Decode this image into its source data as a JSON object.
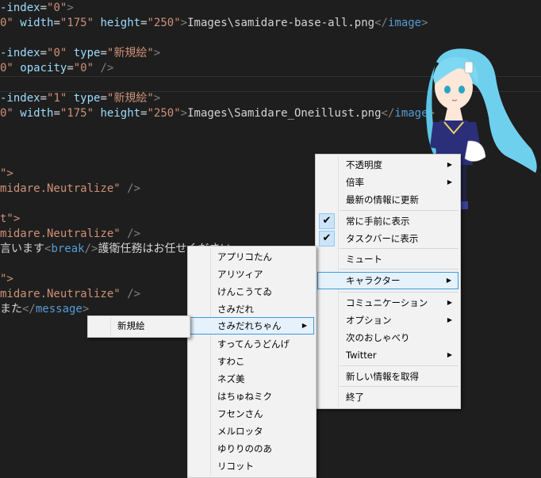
{
  "editor": {
    "lines": [
      [
        {
          "c": "t-attr",
          "t": "-index"
        },
        {
          "c": "t-eq",
          "t": "="
        },
        {
          "c": "t-str",
          "t": "\"0\""
        },
        {
          "c": "t-punc",
          "t": ">"
        }
      ],
      [
        {
          "c": "t-str",
          "t": "0\""
        },
        {
          "c": "t-txt",
          "t": " "
        },
        {
          "c": "t-attr",
          "t": "width"
        },
        {
          "c": "t-eq",
          "t": "="
        },
        {
          "c": "t-str",
          "t": "\"175\""
        },
        {
          "c": "t-txt",
          "t": " "
        },
        {
          "c": "t-attr",
          "t": "height"
        },
        {
          "c": "t-eq",
          "t": "="
        },
        {
          "c": "t-str",
          "t": "\"250\""
        },
        {
          "c": "t-punc",
          "t": ">"
        },
        {
          "c": "t-txt",
          "t": "Images\\samidare-base-all.png"
        },
        {
          "c": "t-punc",
          "t": "</"
        },
        {
          "c": "t-tag",
          "t": "image"
        },
        {
          "c": "t-punc",
          "t": ">"
        }
      ],
      [],
      [
        {
          "c": "t-attr",
          "t": "-index"
        },
        {
          "c": "t-eq",
          "t": "="
        },
        {
          "c": "t-str",
          "t": "\"0\""
        },
        {
          "c": "t-txt",
          "t": " "
        },
        {
          "c": "t-attr",
          "t": "type"
        },
        {
          "c": "t-eq",
          "t": "="
        },
        {
          "c": "t-str",
          "t": "\"新規絵\""
        },
        {
          "c": "t-punc",
          "t": ">"
        }
      ],
      [
        {
          "c": "t-str",
          "t": "0\""
        },
        {
          "c": "t-txt",
          "t": " "
        },
        {
          "c": "t-attr",
          "t": "opacity"
        },
        {
          "c": "t-eq",
          "t": "="
        },
        {
          "c": "t-str",
          "t": "\"0\""
        },
        {
          "c": "t-txt",
          "t": " "
        },
        {
          "c": "t-punc",
          "t": "/>"
        }
      ],
      [],
      [
        {
          "c": "t-attr",
          "t": "-index"
        },
        {
          "c": "t-eq",
          "t": "="
        },
        {
          "c": "t-str",
          "t": "\"1\""
        },
        {
          "c": "t-txt",
          "t": " "
        },
        {
          "c": "t-attr",
          "t": "type"
        },
        {
          "c": "t-eq",
          "t": "="
        },
        {
          "c": "t-str",
          "t": "\"新規絵\""
        },
        {
          "c": "t-punc",
          "t": ">"
        }
      ],
      [
        {
          "c": "t-str",
          "t": "0\""
        },
        {
          "c": "t-txt",
          "t": " "
        },
        {
          "c": "t-attr",
          "t": "width"
        },
        {
          "c": "t-eq",
          "t": "="
        },
        {
          "c": "t-str",
          "t": "\"175\""
        },
        {
          "c": "t-txt",
          "t": " "
        },
        {
          "c": "t-attr",
          "t": "height"
        },
        {
          "c": "t-eq",
          "t": "="
        },
        {
          "c": "t-str",
          "t": "\"250\""
        },
        {
          "c": "t-punc",
          "t": ">"
        },
        {
          "c": "t-txt",
          "t": "Images\\Samidare_Oneillust.png"
        },
        {
          "c": "t-punc",
          "t": "</"
        },
        {
          "c": "t-tag",
          "t": "image"
        },
        {
          "c": "t-punc",
          "t": ">"
        }
      ],
      [],
      [],
      [],
      [
        {
          "c": "t-str",
          "t": "\">"
        }
      ],
      [
        {
          "c": "t-str",
          "t": "midare.Neutralize\""
        },
        {
          "c": "t-txt",
          "t": " "
        },
        {
          "c": "t-punc",
          "t": "/>"
        }
      ],
      [],
      [
        {
          "c": "t-str",
          "t": "t\">"
        }
      ],
      [
        {
          "c": "t-str",
          "t": "midare.Neutralize\""
        },
        {
          "c": "t-txt",
          "t": " "
        },
        {
          "c": "t-punc",
          "t": "/>"
        }
      ],
      [
        {
          "c": "t-txt",
          "t": "言います"
        },
        {
          "c": "t-punc",
          "t": "<"
        },
        {
          "c": "t-tag",
          "t": "break"
        },
        {
          "c": "t-punc",
          "t": "/>"
        },
        {
          "c": "t-txt",
          "t": "護衛任務はお任せください"
        }
      ],
      [],
      [
        {
          "c": "t-str",
          "t": "\">"
        }
      ],
      [
        {
          "c": "t-str",
          "t": "midare.Neutralize\""
        },
        {
          "c": "t-txt",
          "t": " "
        },
        {
          "c": "t-punc",
          "t": "/>"
        }
      ],
      [
        {
          "c": "t-txt",
          "t": "また"
        },
        {
          "c": "t-punc",
          "t": "</"
        },
        {
          "c": "t-tag",
          "t": "message"
        },
        {
          "c": "t-punc",
          "t": ">"
        }
      ]
    ]
  },
  "main_menu": {
    "items": [
      {
        "key": "opacity",
        "label": "不透明度",
        "submenu": true
      },
      {
        "key": "zoom",
        "label": "倍率",
        "submenu": true
      },
      {
        "key": "refresh",
        "label": "最新の情報に更新"
      },
      {
        "sep": true
      },
      {
        "key": "always-on-top",
        "label": "常に手前に表示",
        "checked": true
      },
      {
        "key": "show-in-taskbar",
        "label": "タスクバーに表示",
        "checked": true
      },
      {
        "sep": true
      },
      {
        "key": "mute",
        "label": "ミュート"
      },
      {
        "sep": true
      },
      {
        "key": "character",
        "label": "キャラクター",
        "submenu": true,
        "selected": true
      },
      {
        "sep": true
      },
      {
        "key": "communication",
        "label": "コミュニケーション",
        "submenu": true
      },
      {
        "key": "options",
        "label": "オプション",
        "submenu": true
      },
      {
        "key": "next-talk",
        "label": "次のおしゃべり"
      },
      {
        "key": "twitter",
        "label": "Twitter",
        "submenu": true
      },
      {
        "sep": true
      },
      {
        "key": "get-new-info",
        "label": "新しい情報を取得"
      },
      {
        "sep": true
      },
      {
        "key": "exit",
        "label": "終了"
      }
    ]
  },
  "character_menu": {
    "items": [
      {
        "key": "apurikotan",
        "label": "アプリコたん"
      },
      {
        "key": "alicia",
        "label": "アリツィア"
      },
      {
        "key": "kenkoute",
        "label": "けんこうてゐ"
      },
      {
        "key": "samidare",
        "label": "さみだれ"
      },
      {
        "key": "samidare-chan",
        "label": "さみだれちゃん",
        "submenu": true,
        "selected": true
      },
      {
        "key": "sutten",
        "label": "すってんうどんげ"
      },
      {
        "key": "suwako",
        "label": "すわこ"
      },
      {
        "key": "nezumi",
        "label": "ネズ美"
      },
      {
        "key": "hachune",
        "label": "はちゅねミク"
      },
      {
        "key": "fusen",
        "label": "フセンさん"
      },
      {
        "key": "merlotta",
        "label": "メルロッタ"
      },
      {
        "key": "yuri",
        "label": "ゆりりののあ"
      },
      {
        "key": "ricotte",
        "label": "リコット"
      }
    ]
  },
  "sub_menu": {
    "items": [
      {
        "key": "new-image",
        "label": "新規絵"
      }
    ]
  },
  "icons": {
    "checkmark": "✔",
    "submenu_arrow": "▶"
  },
  "colors": {
    "editor_bg": "#1e1e1e",
    "menu_bg": "#f2f2f2",
    "highlight_border": "#3a9be0",
    "highlight_bg": "#e5f1fb"
  }
}
